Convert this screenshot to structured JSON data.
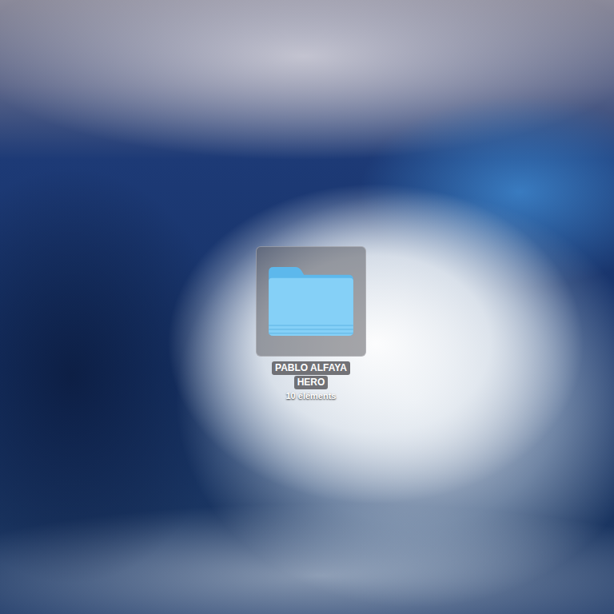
{
  "desktop": {
    "icons": [
      {
        "label_lines": [
          "PABLO ALFAYA",
          "HERO"
        ],
        "info": "10 éléments",
        "selected": true
      }
    ]
  }
}
